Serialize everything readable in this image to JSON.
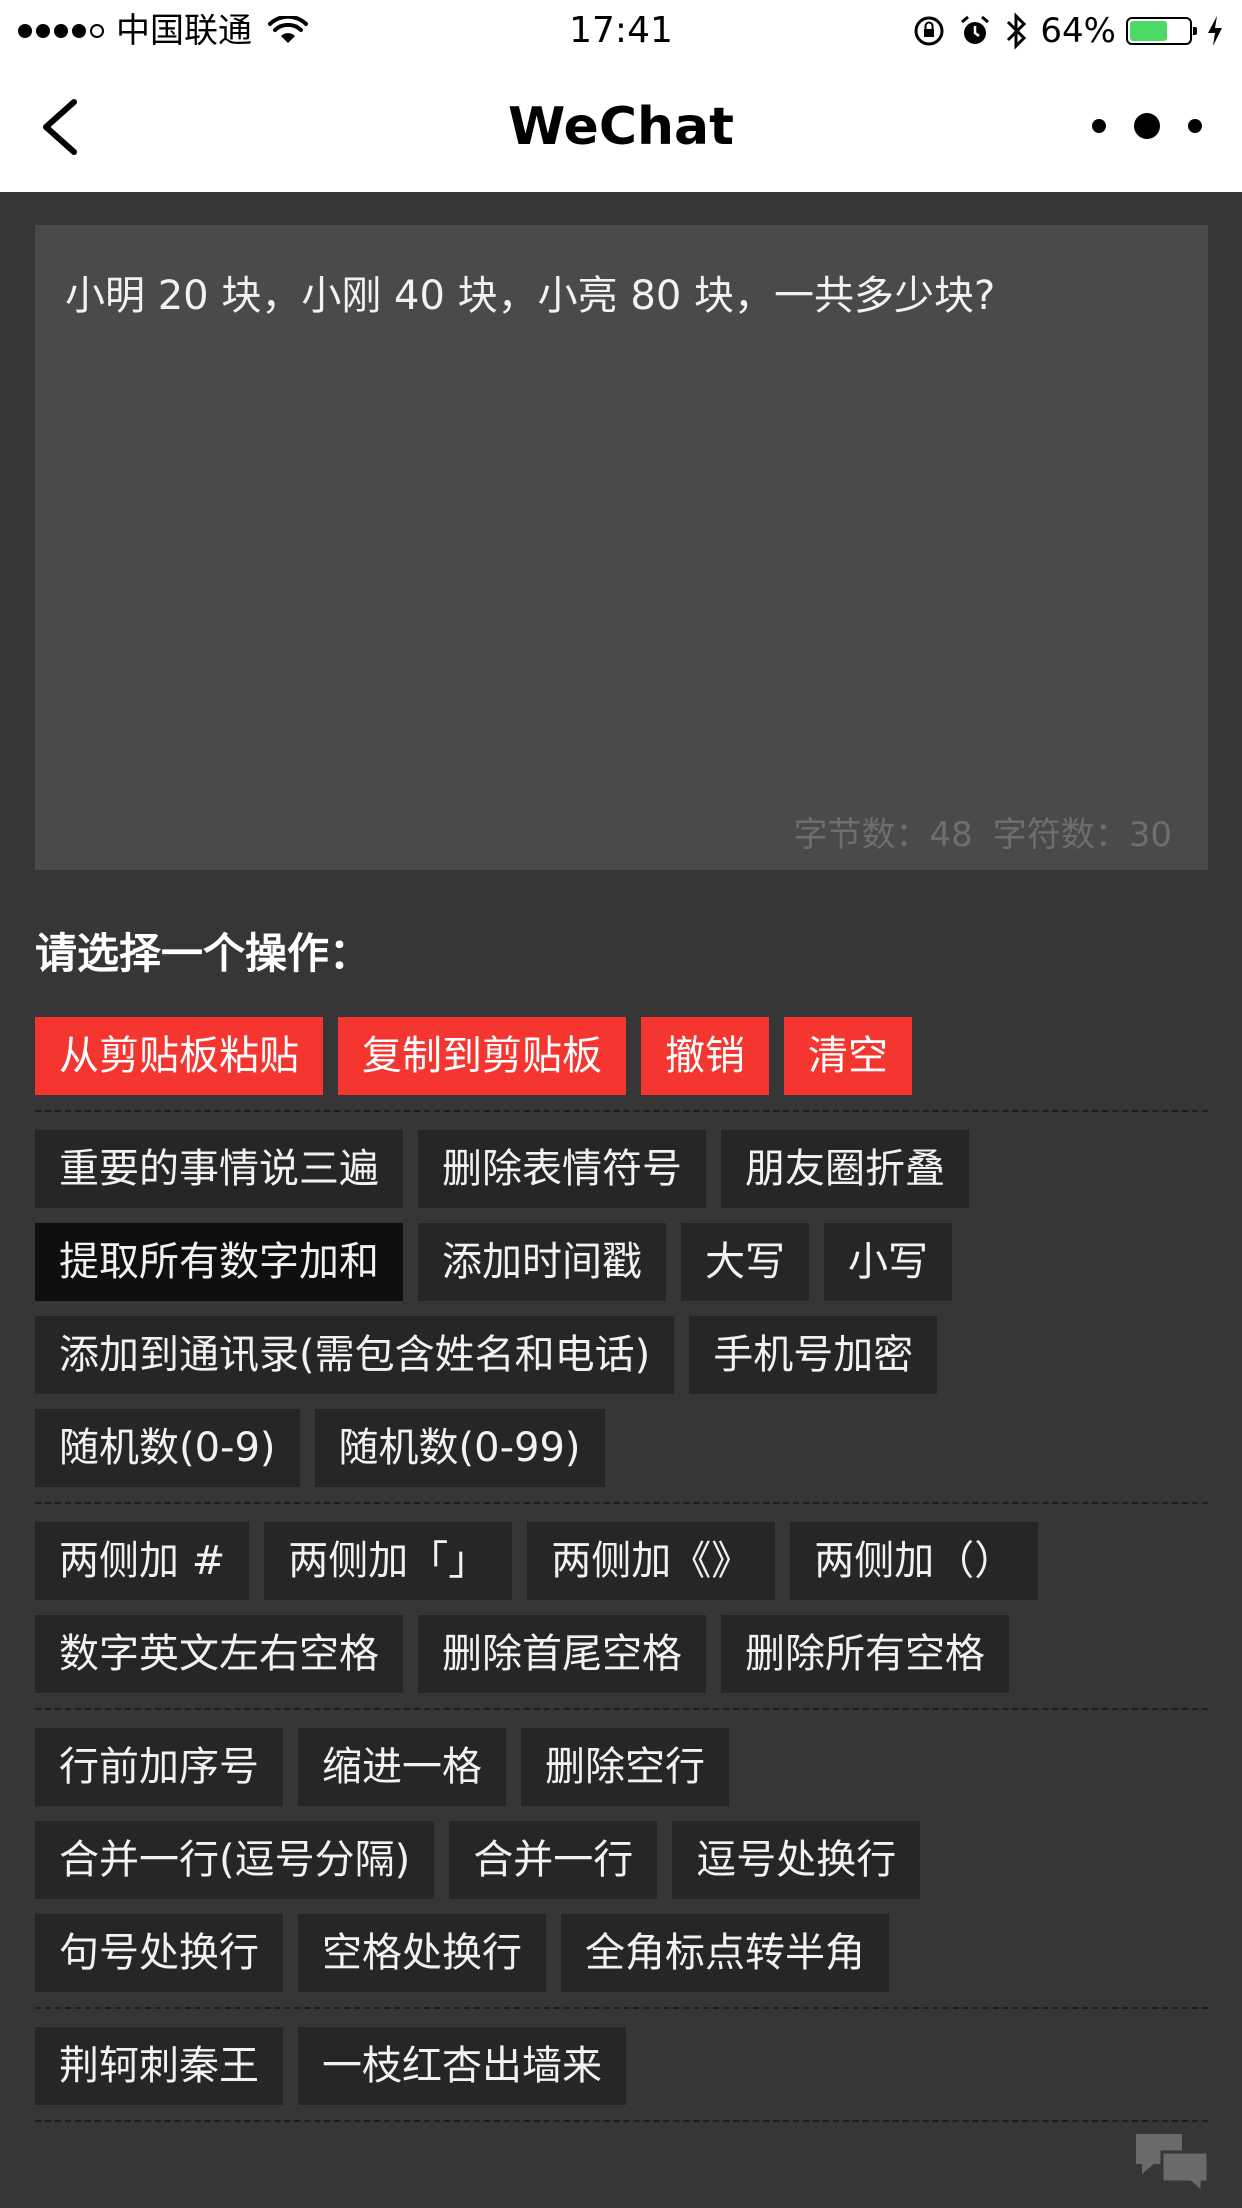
{
  "status_bar": {
    "carrier": "中国联通",
    "time": "17:41",
    "battery_percent": "64%",
    "battery_level": 0.64,
    "battery_color": "#4cd964"
  },
  "nav": {
    "title": "WeChat",
    "back_icon": "chevron-left-icon",
    "more_icon": "more-dots-icon"
  },
  "editor": {
    "text": "小明 20 块，小刚 40 块，小亮 80 块，一共多少块?",
    "byte_count": "字节数：48",
    "char_count": "字符数：30"
  },
  "prompt": "请选择一个操作：",
  "groups": [
    {
      "rows": [
        [
          {
            "label": "从剪贴板粘贴",
            "style": "red"
          },
          {
            "label": "复制到剪贴板",
            "style": "red"
          },
          {
            "label": "撤销",
            "style": "red"
          },
          {
            "label": "清空",
            "style": "red"
          }
        ]
      ]
    },
    {
      "rows": [
        [
          {
            "label": "重要的事情说三遍",
            "style": "normal"
          },
          {
            "label": "删除表情符号",
            "style": "normal"
          },
          {
            "label": "朋友圈折叠",
            "style": "normal"
          }
        ],
        [
          {
            "label": "提取所有数字加和",
            "style": "dark"
          },
          {
            "label": "添加时间戳",
            "style": "normal"
          },
          {
            "label": "大写",
            "style": "normal"
          },
          {
            "label": "小写",
            "style": "normal"
          }
        ],
        [
          {
            "label": "添加到通讯录(需包含姓名和电话)",
            "style": "normal"
          },
          {
            "label": "手机号加密",
            "style": "normal"
          }
        ],
        [
          {
            "label": "随机数(0-9)",
            "style": "normal"
          },
          {
            "label": "随机数(0-99)",
            "style": "normal"
          }
        ]
      ]
    },
    {
      "rows": [
        [
          {
            "label": "两侧加 #",
            "style": "normal"
          },
          {
            "label": "两侧加「」",
            "style": "normal"
          },
          {
            "label": "两侧加《》",
            "style": "normal"
          },
          {
            "label": "两侧加（）",
            "style": "normal"
          }
        ],
        [
          {
            "label": "数字英文左右空格",
            "style": "normal"
          },
          {
            "label": "删除首尾空格",
            "style": "normal"
          },
          {
            "label": "删除所有空格",
            "style": "normal"
          }
        ]
      ]
    },
    {
      "rows": [
        [
          {
            "label": "行前加序号",
            "style": "normal"
          },
          {
            "label": "缩进一格",
            "style": "normal"
          },
          {
            "label": "删除空行",
            "style": "normal"
          }
        ],
        [
          {
            "label": "合并一行(逗号分隔)",
            "style": "normal"
          },
          {
            "label": "合并一行",
            "style": "normal"
          },
          {
            "label": "逗号处换行",
            "style": "normal"
          }
        ],
        [
          {
            "label": "句号处换行",
            "style": "normal"
          },
          {
            "label": "空格处换行",
            "style": "normal"
          },
          {
            "label": "全角标点转半角",
            "style": "normal"
          }
        ]
      ]
    },
    {
      "rows": [
        [
          {
            "label": "荆轲刺秦王",
            "style": "normal"
          },
          {
            "label": "一枝红杏出墙来",
            "style": "normal"
          }
        ]
      ]
    }
  ],
  "colors": {
    "background": "#363636",
    "button": "#262626",
    "button_accent": "#f43530",
    "editor_bg": "#4a4a4a"
  }
}
